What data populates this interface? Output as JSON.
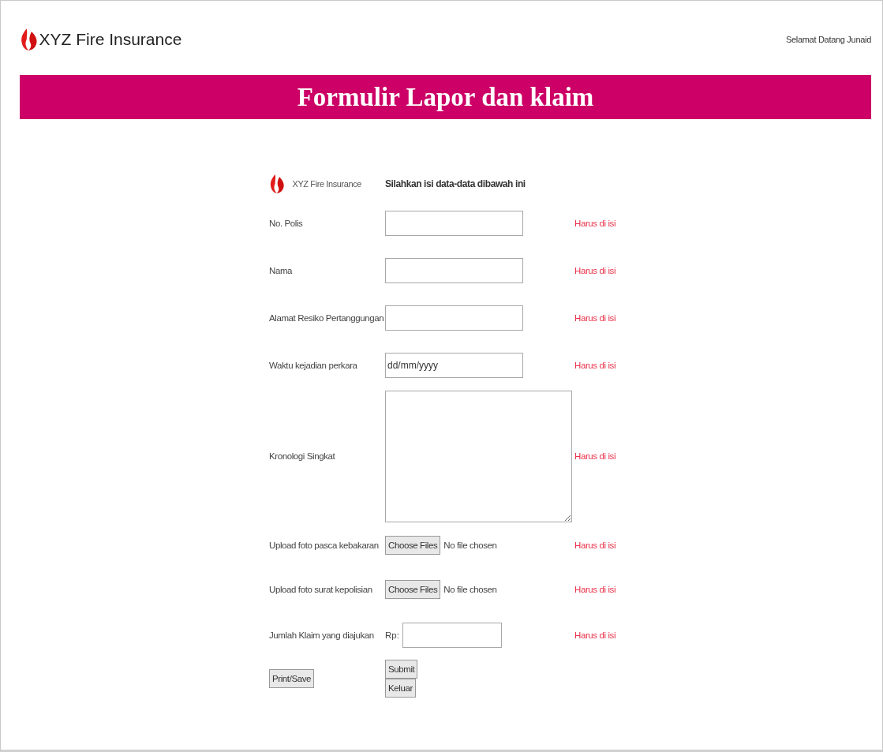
{
  "header": {
    "brand": "XYZ Fire Insurance",
    "greeting": "Selamat Datang Junaid"
  },
  "banner": {
    "title": "Formulir Lapor dan klaim"
  },
  "form": {
    "brand": "XYZ Fire Insurance",
    "instruction": "Silahkan isi data-data dibawah ini",
    "fields": [
      {
        "kind": "text",
        "label": "No. Polis",
        "note": "Harus di isi"
      },
      {
        "kind": "text",
        "label": "Nama",
        "note": "Harus di isi"
      },
      {
        "kind": "text",
        "label": "Alamat Resiko Pertanggungan",
        "note": "Harus di isi"
      },
      {
        "kind": "date",
        "label": "Waktu kejadian perkara",
        "value": "dd/mm/yyyy",
        "note": "Harus di isi"
      },
      {
        "kind": "textarea",
        "label": "Kronologi Singkat",
        "note": "Harus di isi"
      },
      {
        "kind": "file",
        "label": "Upload foto pasca kebakaran",
        "button": "Choose Files",
        "status": "No file chosen",
        "note": "Harus di isi"
      },
      {
        "kind": "file",
        "label": "Upload foto surat kepolisian",
        "button": "Choose Files",
        "status": "No file chosen",
        "note": "Harus di isi"
      },
      {
        "kind": "money",
        "label": "Jumlah Klaim yang diajukan",
        "prefix": "Rp:",
        "note": "Harus di isi"
      }
    ],
    "buttons": {
      "print": "Print/Save",
      "submit": "Submit",
      "exit": "Keluar"
    }
  }
}
